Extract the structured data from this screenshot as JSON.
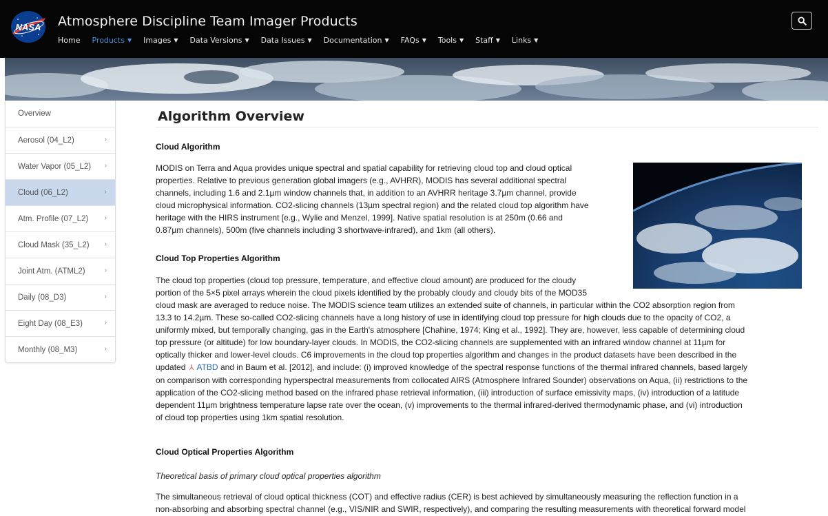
{
  "header": {
    "site_title": "Atmosphere Discipline Team Imager Products",
    "logo_text": "NASA",
    "nav": [
      {
        "label": "Home"
      },
      {
        "label": "Products"
      },
      {
        "label": "Images"
      },
      {
        "label": "Data Versions"
      },
      {
        "label": "Data Issues"
      },
      {
        "label": "Documentation"
      },
      {
        "label": "FAQs"
      },
      {
        "label": "Tools"
      },
      {
        "label": "Staff"
      },
      {
        "label": "Links"
      }
    ],
    "active_nav": "Products",
    "search_icon": "search-icon"
  },
  "sidebar": {
    "items": [
      {
        "label": "Overview"
      },
      {
        "label": "Aerosol (04_L2)"
      },
      {
        "label": "Water Vapor (05_L2)"
      },
      {
        "label": "Cloud (06_L2)"
      },
      {
        "label": "Atm. Profile (07_L2)"
      },
      {
        "label": "Cloud Mask (35_L2)"
      },
      {
        "label": "Joint Atm. (ATML2)"
      },
      {
        "label": "Daily (08_D3)"
      },
      {
        "label": "Eight Day (08_E3)"
      },
      {
        "label": "Monthly (08_M3)"
      }
    ],
    "active_item": "Cloud (06_L2)"
  },
  "main": {
    "title": "Algorithm Overview",
    "cloud_algorithm": {
      "heading": "Cloud Algorithm",
      "lines": [
        "MODIS on Terra and Aqua provides unique spectral and spatial capability for retrieving cloud top and cloud optical",
        "properties. Relative to previous generation global imagers (e.g., AVHRR), MODIS has several additional spectral",
        "channels, including 1.6 and 2.1µm window channels that, in addition to an AVHRR heritage 3.7µm channel, provide",
        "cloud microphysical information. CO2-slicing channels (13µm spectral region) and the related cloud top algorithm have",
        "heritage with the HIRS instrument [e.g., Wylie and Menzel, 1999]. Native spatial resolution is at 250m (0.66 and",
        "0.87µm channels), 500m (five channels including 3 shortwave-infrared), and 1km (all others)."
      ]
    },
    "cloud_top": {
      "heading": "Cloud Top Properties Algorithm",
      "lines": [
        "The cloud top properties (cloud top pressure, temperature, and effective cloud amount) are produced for the cloudy",
        "portion of the 5×5 pixel arrays wherein the cloud pixels identified by the probably cloudy and cloudy bits of the MOD35",
        "cloud mask are averaged to reduce noise. The MODIS science team utilizes an extended suite of channels, in particular within the CO2 absorption region from",
        "13.3 to 14.2µm. These so-called CO2-slicing channels have a long history of use in identifying cloud top pressure for high clouds due to the opacity of CO2, a",
        "uniformly mixed, but temporally changing, gas in the Earth's atmosphere [Chahine, 1974; King et al., 1992]. They are, however, less capable of determining cloud",
        "top pressure (or altitude) for low boundary-layer clouds. In MODIS, the CO2-slicing channels are supplemented with an infrared window channel at 11µm for",
        "optically thicker and lower-level clouds. C6 improvements in the cloud top properties algorithm and changes in the product datasets have been described in the"
      ],
      "line_pre_link": "updated",
      "link_label": "ATBD",
      "line_post_link": "and in Baum et al. [2012], and include: (i) improved knowledge of the spectral response functions of the thermal infrared channels, based largely",
      "lines_after": [
        "on comparison with corresponding hyperspectral measurements from collocated AIRS (Atmosphere Infrared Sounder) observations on Aqua, (ii) restrictions to the",
        "application of the CO2-slicing method based on the infrared phase retrieval information, (iii) introduction of surface emissivity maps, (iv) introduction of a latitude",
        "dependent 11µm brightness temperature lapse rate over the ocean, (v) improvements to the thermal infrared-derived thermodynamic phase, and (vi) introduction",
        "of cloud top properties using 1km spatial resolution."
      ]
    },
    "cloud_optical": {
      "heading": "Cloud Optical Properties Algorithm",
      "subheading": "Theoretical basis of primary cloud optical properties algorithm",
      "lines": [
        "The simultaneous retrieval of cloud optical thickness (COT) and effective radius (CER) is best achieved by simultaneously measuring the reflection function in a",
        "non-absorbing and absorbing spectral channel (e.g., VIS/NIR and SWIR, respectively), and comparing the resulting measurements with theoretical forward model"
      ]
    }
  }
}
